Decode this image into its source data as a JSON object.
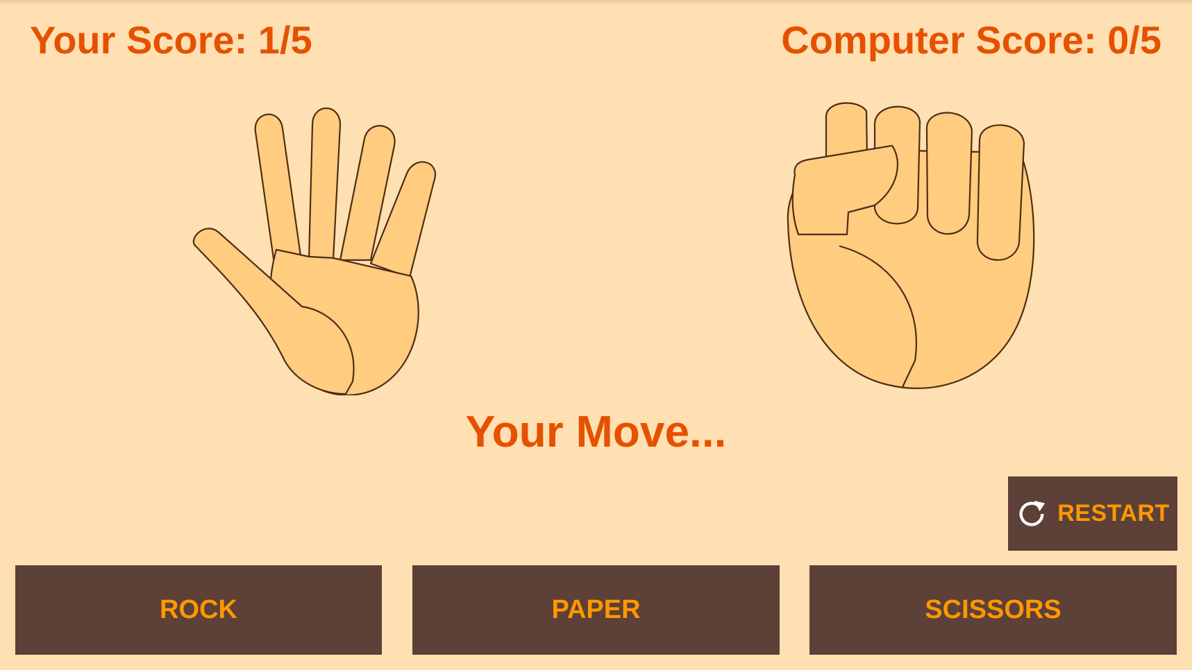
{
  "scores": {
    "player": "Your Score: 1/5",
    "computer": "Computer Score: 0/5"
  },
  "hands": {
    "player": {
      "move": "paper",
      "icon": "paper-hand-icon"
    },
    "computer": {
      "move": "rock",
      "icon": "rock-fist-icon"
    }
  },
  "status": {
    "message": "Your Move..."
  },
  "controls": {
    "restart_label": "RESTART",
    "restart_icon": "refresh-icon",
    "rock_label": "ROCK",
    "paper_label": "PAPER",
    "scissors_label": "SCISSORS"
  },
  "colors": {
    "background": "#FFE0B2",
    "accent_text": "#E65100",
    "button_bg": "#5D4037",
    "button_text": "#FF9800",
    "skin": "#FFCC80",
    "outline": "#4E2C14"
  }
}
